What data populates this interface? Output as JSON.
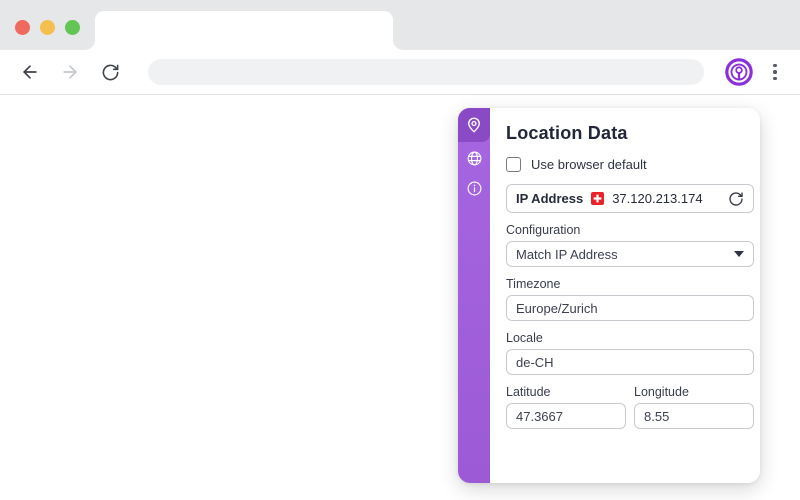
{
  "browser": {
    "address_value": "",
    "controls": {
      "close_color": "#EE6A5F",
      "minimize_color": "#F5BF4F",
      "maximize_color": "#62C554"
    },
    "extension_accent": "#8B2FDB"
  },
  "panel": {
    "title": "Location Data",
    "accent": "#9C5AD6",
    "accent_active": "#8A4AC6",
    "sidebar": {
      "items": [
        {
          "label": "location",
          "icon": "map-pin-icon",
          "active": true
        },
        {
          "label": "network",
          "icon": "globe-icon",
          "active": false
        },
        {
          "label": "about",
          "icon": "info-icon",
          "active": false
        }
      ]
    },
    "browser_default_checkbox": {
      "label": "Use browser default",
      "checked": false
    },
    "ip": {
      "label": "IP Address",
      "value": "37.120.213.174",
      "flag": "swiss-flag",
      "flag_color": "#E8232A"
    },
    "fields": {
      "configuration": {
        "label": "Configuration",
        "value": "Match IP Address"
      },
      "timezone": {
        "label": "Timezone",
        "value": "Europe/Zurich"
      },
      "locale": {
        "label": "Locale",
        "value": "de-CH"
      },
      "latitude": {
        "label": "Latitude",
        "value": "47.3667"
      },
      "longitude": {
        "label": "Longitude",
        "value": "8.55"
      }
    }
  }
}
